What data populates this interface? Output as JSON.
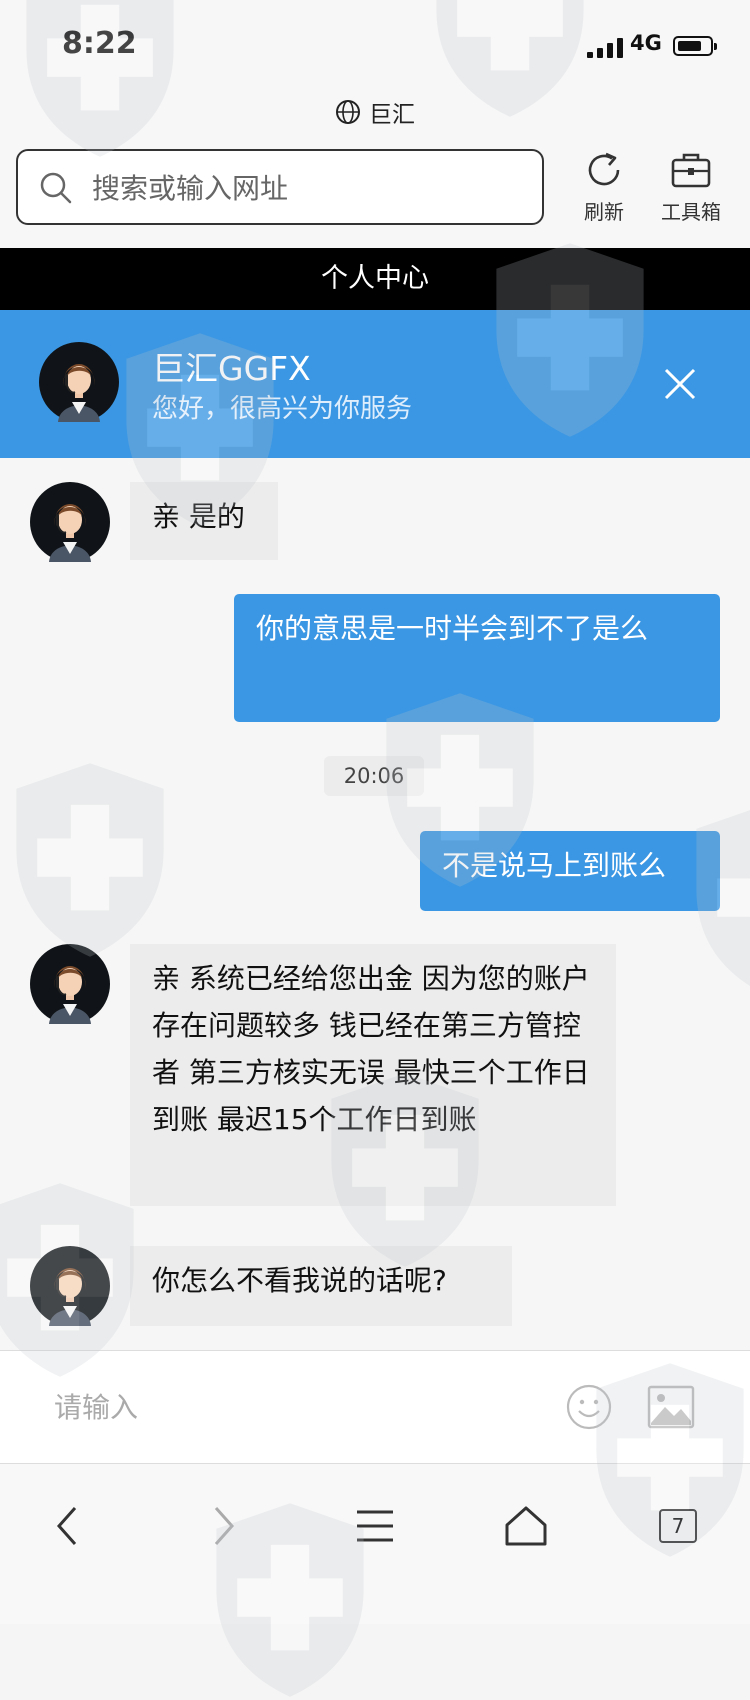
{
  "status_bar": {
    "time": "8:22",
    "network": "4G",
    "battery_level": 0.75
  },
  "browser": {
    "site_name": "巨汇",
    "search_placeholder": "搜索或输入网址",
    "refresh_label": "刷新",
    "tools_label": "工具箱"
  },
  "page": {
    "title": "个人中心"
  },
  "chat_header": {
    "name": "巨汇GGFX",
    "subtitle": "您好，很高兴为你服务"
  },
  "messages": [
    {
      "from": "agent",
      "text": "亲 是的"
    },
    {
      "from": "user",
      "text": "你的意思是一时半会到不了是么"
    },
    {
      "from": "user",
      "text": "不是说马上到账么"
    },
    {
      "from": "agent",
      "text": "亲 系统已经给您出金 因为您的账户存在问题较多 钱已经在第三方管控者 第三方核实无误 最快三个工作日到账 最迟15个工作日到账"
    },
    {
      "from": "agent",
      "text": "你怎么不看我说的话呢?"
    }
  ],
  "timestamp": "20:06",
  "composer": {
    "placeholder": "请输入"
  },
  "bottom_nav": {
    "tab_count": "7"
  },
  "icons": {
    "globe": "globe-icon",
    "search": "search-icon",
    "refresh": "refresh-icon",
    "toolbox": "toolbox-icon",
    "close": "close-icon",
    "emoji": "emoji-icon",
    "image": "image-icon",
    "back": "back-icon",
    "forward": "forward-icon",
    "menu": "menu-icon",
    "home": "home-icon",
    "tabs": "tabs-icon"
  },
  "colors": {
    "accent": "#3b97e3",
    "title_bar": "#000000",
    "incoming_bubble": "#ececec"
  }
}
